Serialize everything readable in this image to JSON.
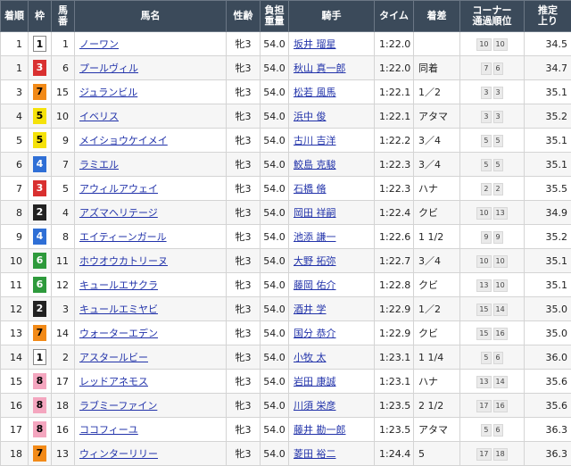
{
  "headers": {
    "rank": "着順",
    "waku": "枠",
    "umaban_1": "馬",
    "umaban_2": "番",
    "name": "馬名",
    "sexage": "性齢",
    "weight_1": "負担",
    "weight_2": "重量",
    "jockey": "騎手",
    "time": "タイム",
    "margin": "着差",
    "corner_1": "コーナー",
    "corner_2": "通過順位",
    "last_1": "推定",
    "last_2": "上り"
  },
  "colors": {
    "header_bg": "#3b4a5a",
    "link": "#2233aa",
    "waku_1": "#ffffff",
    "waku_2": "#222222",
    "waku_3": "#d93030",
    "waku_4": "#2f6fd6",
    "waku_5": "#f5e20a",
    "waku_6": "#2e9a3c",
    "waku_7": "#f28a18",
    "waku_8": "#f4a6bf"
  },
  "rows": [
    {
      "rank": "1",
      "waku": "1",
      "umaban": "1",
      "name": "ノーワン",
      "sexage": "牝3",
      "weight": "54.0",
      "jockey": "坂井 瑠星",
      "time": "1:22.0",
      "margin": "",
      "c1": "10",
      "c2": "10",
      "last": "34.5"
    },
    {
      "rank": "1",
      "waku": "3",
      "umaban": "6",
      "name": "プールヴィル",
      "sexage": "牝3",
      "weight": "54.0",
      "jockey": "秋山 真一郎",
      "time": "1:22.0",
      "margin": "同着",
      "c1": "7",
      "c2": "6",
      "last": "34.7"
    },
    {
      "rank": "3",
      "waku": "7",
      "umaban": "15",
      "name": "ジュランビル",
      "sexage": "牝3",
      "weight": "54.0",
      "jockey": "松若 風馬",
      "time": "1:22.1",
      "margin": "1／2",
      "c1": "3",
      "c2": "3",
      "last": "35.1"
    },
    {
      "rank": "4",
      "waku": "5",
      "umaban": "10",
      "name": "イベリス",
      "sexage": "牝3",
      "weight": "54.0",
      "jockey": "浜中 俊",
      "time": "1:22.1",
      "margin": "アタマ",
      "c1": "3",
      "c2": "3",
      "last": "35.2"
    },
    {
      "rank": "5",
      "waku": "5",
      "umaban": "9",
      "name": "メイショウケイメイ",
      "sexage": "牝3",
      "weight": "54.0",
      "jockey": "古川 吉洋",
      "time": "1:22.2",
      "margin": "3／4",
      "c1": "5",
      "c2": "5",
      "last": "35.1"
    },
    {
      "rank": "6",
      "waku": "4",
      "umaban": "7",
      "name": "ラミエル",
      "sexage": "牝3",
      "weight": "54.0",
      "jockey": "鮫島 克駿",
      "time": "1:22.3",
      "margin": "3／4",
      "c1": "5",
      "c2": "5",
      "last": "35.1"
    },
    {
      "rank": "7",
      "waku": "3",
      "umaban": "5",
      "name": "アウィルアウェイ",
      "sexage": "牝3",
      "weight": "54.0",
      "jockey": "石橋 脩",
      "time": "1:22.3",
      "margin": "ハナ",
      "c1": "2",
      "c2": "2",
      "last": "35.5"
    },
    {
      "rank": "8",
      "waku": "2",
      "umaban": "4",
      "name": "アズマヘリテージ",
      "sexage": "牝3",
      "weight": "54.0",
      "jockey": "岡田 祥嗣",
      "time": "1:22.4",
      "margin": "クビ",
      "c1": "10",
      "c2": "13",
      "last": "34.9"
    },
    {
      "rank": "9",
      "waku": "4",
      "umaban": "8",
      "name": "エイティーンガール",
      "sexage": "牝3",
      "weight": "54.0",
      "jockey": "池添 謙一",
      "time": "1:22.6",
      "margin": "1 1/2",
      "c1": "9",
      "c2": "9",
      "last": "35.2"
    },
    {
      "rank": "10",
      "waku": "6",
      "umaban": "11",
      "name": "ホウオウカトリーヌ",
      "sexage": "牝3",
      "weight": "54.0",
      "jockey": "大野 拓弥",
      "time": "1:22.7",
      "margin": "3／4",
      "c1": "10",
      "c2": "10",
      "last": "35.1"
    },
    {
      "rank": "11",
      "waku": "6",
      "umaban": "12",
      "name": "キュールエサクラ",
      "sexage": "牝3",
      "weight": "54.0",
      "jockey": "藤岡 佑介",
      "time": "1:22.8",
      "margin": "クビ",
      "c1": "13",
      "c2": "10",
      "last": "35.1"
    },
    {
      "rank": "12",
      "waku": "2",
      "umaban": "3",
      "name": "キュールエミヤビ",
      "sexage": "牝3",
      "weight": "54.0",
      "jockey": "酒井 学",
      "time": "1:22.9",
      "margin": "1／2",
      "c1": "15",
      "c2": "14",
      "last": "35.0"
    },
    {
      "rank": "13",
      "waku": "7",
      "umaban": "14",
      "name": "ウォーターエデン",
      "sexage": "牝3",
      "weight": "54.0",
      "jockey": "国分 恭介",
      "time": "1:22.9",
      "margin": "クビ",
      "c1": "15",
      "c2": "16",
      "last": "35.0"
    },
    {
      "rank": "14",
      "waku": "1",
      "umaban": "2",
      "name": "アスタールビー",
      "sexage": "牝3",
      "weight": "54.0",
      "jockey": "小牧 太",
      "time": "1:23.1",
      "margin": "1 1/4",
      "c1": "5",
      "c2": "6",
      "last": "36.0"
    },
    {
      "rank": "15",
      "waku": "8",
      "umaban": "17",
      "name": "レッドアネモス",
      "sexage": "牝3",
      "weight": "54.0",
      "jockey": "岩田 康誠",
      "time": "1:23.1",
      "margin": "ハナ",
      "c1": "13",
      "c2": "14",
      "last": "35.6"
    },
    {
      "rank": "16",
      "waku": "8",
      "umaban": "18",
      "name": "ラブミーファイン",
      "sexage": "牝3",
      "weight": "54.0",
      "jockey": "川須 栄彦",
      "time": "1:23.5",
      "margin": "2 1/2",
      "c1": "17",
      "c2": "16",
      "last": "35.6"
    },
    {
      "rank": "17",
      "waku": "8",
      "umaban": "16",
      "name": "ココフィーユ",
      "sexage": "牝3",
      "weight": "54.0",
      "jockey": "藤井 勘一郎",
      "time": "1:23.5",
      "margin": "アタマ",
      "c1": "5",
      "c2": "6",
      "last": "36.3"
    },
    {
      "rank": "18",
      "waku": "7",
      "umaban": "13",
      "name": "ウィンターリリー",
      "sexage": "牝3",
      "weight": "54.0",
      "jockey": "菱田 裕二",
      "time": "1:24.4",
      "margin": "5",
      "c1": "17",
      "c2": "18",
      "last": "36.3"
    }
  ]
}
